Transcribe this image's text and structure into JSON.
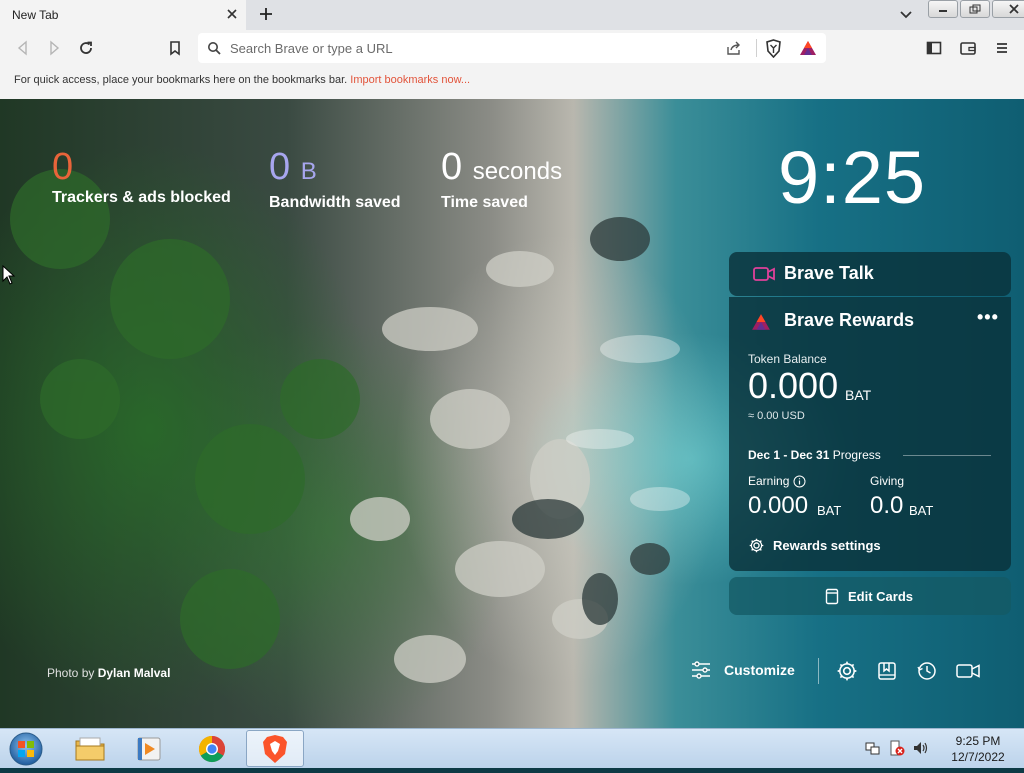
{
  "browser": {
    "tab_title": "New Tab",
    "omnibox_placeholder": "Search Brave or type a URL",
    "bookmarks_bar": {
      "message": "For quick access, place your bookmarks here on the bookmarks bar.",
      "import_link": "Import bookmarks now..."
    }
  },
  "stats": {
    "trackers": {
      "value": "0",
      "label": "Trackers & ads blocked",
      "color": "#e8643a"
    },
    "bandwidth": {
      "value": "0",
      "unit": "B",
      "label": "Bandwidth saved",
      "color": "#a7a6ee"
    },
    "time": {
      "value": "0",
      "unit": "seconds",
      "label": "Time saved",
      "color": "#ffffff"
    }
  },
  "clock": "9:25",
  "brave_talk": {
    "title": "Brave Talk"
  },
  "rewards": {
    "title": "Brave Rewards",
    "more": "•••",
    "token_balance_label": "Token Balance",
    "balance": "0.000",
    "balance_unit": "BAT",
    "usd": "≈ 0.00 USD",
    "period": "Dec 1 - Dec 31",
    "progress_label": "Progress",
    "earning_label": "Earning",
    "earning_value": "0.000",
    "earning_unit": "BAT",
    "giving_label": "Giving",
    "giving_value": "0.0",
    "giving_unit": "BAT",
    "settings_label": "Rewards settings"
  },
  "edit_cards": "Edit Cards",
  "photo_credit": {
    "prefix": "Photo by",
    "author": "Dylan Malval"
  },
  "customize_label": "Customize",
  "taskbar": {
    "time": "9:25 PM",
    "date": "12/7/2022"
  }
}
